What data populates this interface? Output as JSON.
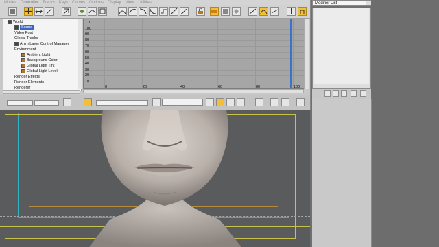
{
  "menu": [
    "Modes",
    "Controller",
    "Tracks",
    "Keys",
    "Curves",
    "Options",
    "Display",
    "View",
    "Utilities"
  ],
  "tree": {
    "items": [
      {
        "label": "World",
        "indent": 0,
        "icon": "world-icon"
      },
      {
        "label": "Sound",
        "indent": 1,
        "icon": "sound-icon",
        "selected": true
      },
      {
        "label": "Video Post",
        "indent": 1,
        "icon": ""
      },
      {
        "label": "Global Tracks",
        "indent": 1,
        "icon": ""
      },
      {
        "label": "Anim Layer Control Manager",
        "indent": 1,
        "icon": "layer-icon"
      },
      {
        "label": "Environment",
        "indent": 1,
        "icon": ""
      },
      {
        "label": "Ambient Light",
        "indent": 2,
        "icon": "track-icon"
      },
      {
        "label": "Background Color",
        "indent": 2,
        "icon": "track-icon"
      },
      {
        "label": "Global Light Tint",
        "indent": 2,
        "icon": "track-icon"
      },
      {
        "label": "Global Light Level",
        "indent": 2,
        "icon": "track-icon"
      },
      {
        "label": "Render Effects",
        "indent": 1,
        "icon": ""
      },
      {
        "label": "Render Elements",
        "indent": 1,
        "icon": ""
      },
      {
        "label": "Renderer",
        "indent": 1,
        "icon": ""
      }
    ]
  },
  "graph": {
    "y_ticks": [
      "110",
      "100",
      "90",
      "80",
      "70",
      "60",
      "50",
      "40",
      "30",
      "20",
      "10"
    ],
    "x_ticks": [
      "0",
      "20",
      "40",
      "60",
      "80",
      "100"
    ]
  },
  "status": {
    "key_field_value": "",
    "frame_field_value": "",
    "value_field_value": ""
  },
  "command_panel": {
    "modifier_list_label": "Modifier List"
  },
  "colors": {
    "accent": "#f2c037",
    "selection": "#3a66c8",
    "safe_frame_yellow": "#c9c24a",
    "safe_frame_cyan": "#2fb6c6"
  }
}
